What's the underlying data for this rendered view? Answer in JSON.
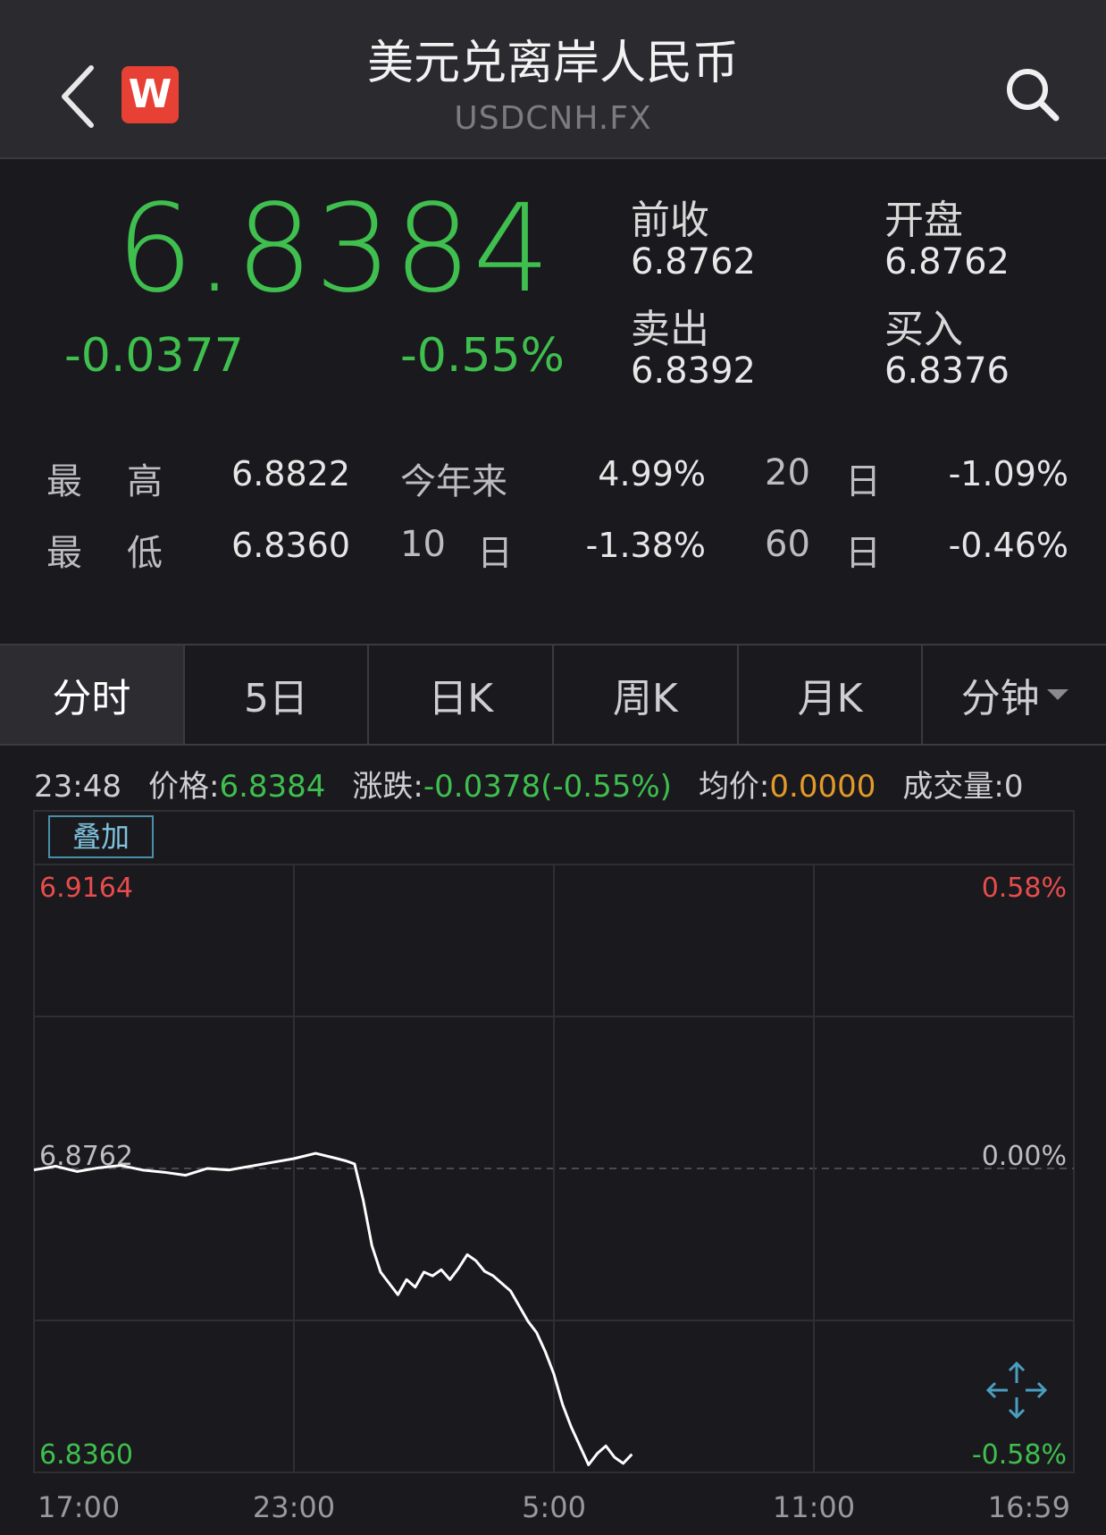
{
  "header": {
    "title": "美元兑离岸人民币",
    "code": "USDCNH.FX",
    "logo_letter": "W"
  },
  "quote": {
    "price": "6.8384",
    "change": "-0.0377",
    "change_pct": "-0.55%",
    "prev_close_label": "前收",
    "prev_close": "6.8762",
    "open_label": "开盘",
    "open": "6.8762",
    "sell_label": "卖出",
    "sell": "6.8392",
    "buy_label": "买入",
    "buy": "6.8376"
  },
  "stats": {
    "high_label_1": "最",
    "high_label_2": "高",
    "high": "6.8822",
    "low_label_1": "最",
    "low_label_2": "低",
    "low": "6.8360",
    "ytd_label": "今年来",
    "ytd": "4.99%",
    "d10_num": "10",
    "d10_unit": "日",
    "d10": "-1.38%",
    "d20_num": "20",
    "d20_unit": "日",
    "d20": "-1.09%",
    "d60_num": "60",
    "d60_unit": "日",
    "d60": "-0.46%"
  },
  "tabs": [
    "分时",
    "5日",
    "日K",
    "周K",
    "月K",
    "分钟"
  ],
  "infobar": {
    "time": "23:48",
    "price_label": "价格:",
    "price": "6.8384",
    "change_label": "涨跌:",
    "change": "-0.0378(-0.55%)",
    "avg_label": "均价:",
    "avg": "0.0000",
    "vol_label": "成交量:",
    "vol": "0"
  },
  "overlay_label": "叠加",
  "colors": {
    "up": "#e84c4c",
    "down": "#3fbf4e",
    "avg": "#e39a2a",
    "bg": "#1a1a1e"
  },
  "chart_data": {
    "type": "line",
    "yleft_ticks": [
      "6.9164",
      "6.8762",
      "6.8360"
    ],
    "yright_ticks": [
      "0.58%",
      "0.00%",
      "-0.58%"
    ],
    "x_ticks": [
      "17:00",
      "23:00",
      "5:00",
      "11:00",
      "16:59"
    ],
    "ylim": [
      6.836,
      6.9164
    ],
    "baseline": 6.8762,
    "series": [
      {
        "x": [
          0,
          0.5,
          1,
          1.5,
          2,
          2.5,
          3,
          3.5,
          4,
          4.5,
          5,
          5.5,
          6,
          6.5,
          7,
          7.2,
          7.4,
          7.6,
          7.8,
          8,
          8.2,
          8.4,
          8.6,
          8.8,
          9,
          9.2,
          9.4,
          9.6,
          9.8,
          10,
          10.2,
          10.4,
          10.6,
          10.8,
          11,
          11.2,
          11.4,
          11.6,
          11.8,
          12,
          12.2,
          12.4,
          12.6,
          12.8,
          13,
          13.2,
          13.4,
          13.6,
          13.8
        ],
        "y": [
          6.876,
          6.8765,
          6.8758,
          6.8763,
          6.8766,
          6.876,
          6.8757,
          6.8753,
          6.8762,
          6.876,
          6.8765,
          6.877,
          6.8775,
          6.8782,
          6.8775,
          6.8772,
          6.8768,
          6.872,
          6.866,
          6.8625,
          6.861,
          6.8595,
          6.8615,
          6.8605,
          6.8625,
          6.862,
          6.8628,
          6.8615,
          6.863,
          6.8648,
          6.864,
          6.8626,
          6.862,
          6.861,
          6.86,
          6.858,
          6.856,
          6.8545,
          6.852,
          6.849,
          6.845,
          6.842,
          6.8395,
          6.837,
          6.8385,
          6.8395,
          6.838,
          6.8372,
          6.8384
        ]
      }
    ]
  }
}
